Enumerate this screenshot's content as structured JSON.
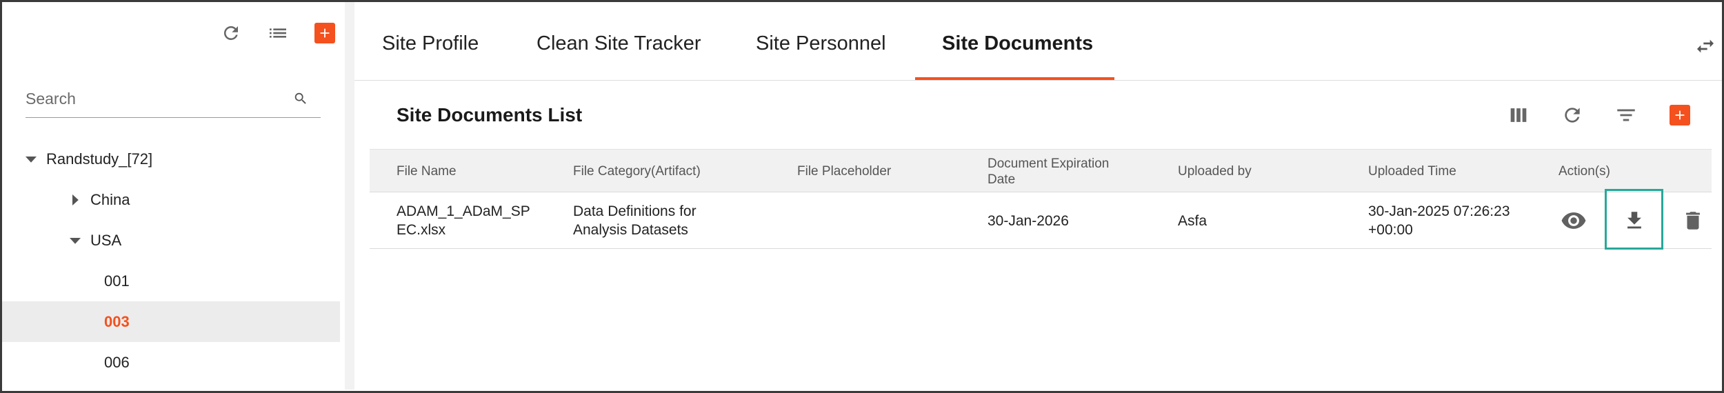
{
  "sidebar": {
    "toolbar": {
      "refresh_icon": "refresh-icon",
      "list_icon": "list-icon",
      "add_icon": "plus-icon"
    },
    "search": {
      "placeholder": "Search",
      "value": ""
    },
    "tree": [
      {
        "label": "Randstudy_[72]",
        "level": 0,
        "caret": "down"
      },
      {
        "label": "China",
        "level": 1,
        "caret": "right"
      },
      {
        "label": "USA",
        "level": 1,
        "caret": "down"
      },
      {
        "label": "001",
        "level": 2,
        "caret": ""
      },
      {
        "label": "003",
        "level": 2,
        "caret": "",
        "selected": true
      },
      {
        "label": "006",
        "level": 2,
        "caret": ""
      }
    ]
  },
  "tabs": [
    {
      "label": "Site Profile"
    },
    {
      "label": "Clean Site Tracker"
    },
    {
      "label": "Site Personnel"
    },
    {
      "label": "Site Documents",
      "active": true
    }
  ],
  "documents": {
    "title": "Site Documents List",
    "toolbar_icons": [
      "columns-icon",
      "refresh-icon",
      "filter-icon",
      "plus-icon"
    ],
    "columns": {
      "file_name": "File Name",
      "file_category": "File Category(Artifact)",
      "file_placeholder": "File Placeholder",
      "expiration_line1": "Document Expiration",
      "expiration_line2": "Date",
      "uploaded_by": "Uploaded by",
      "uploaded_time": "Uploaded Time",
      "actions": "Action(s)"
    },
    "rows": [
      {
        "file_name_line1": "ADAM_1_ADaM_SP",
        "file_name_line2": "EC.xlsx",
        "category_line1": "Data Definitions for",
        "category_line2": "Analysis Datasets",
        "placeholder": "",
        "expiration": "30-Jan-2026",
        "uploaded_by": "Asfa",
        "time_line1": "30-Jan-2025 07:26:23",
        "time_line2": "+00:00"
      }
    ]
  },
  "colors": {
    "accent": "#f4511e",
    "highlight": "#27a89a",
    "icon": "#616161"
  }
}
